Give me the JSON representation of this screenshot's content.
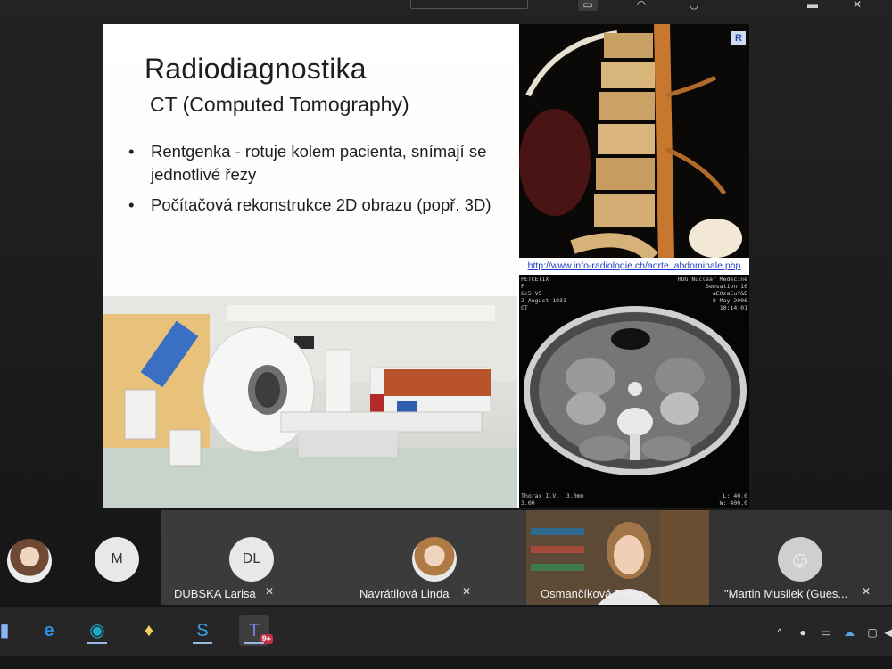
{
  "slide": {
    "title": "Radiodiagnostika",
    "subtitle": "CT (Computed Tomography)",
    "bullets": [
      "Rentgenka -  rotuje kolem pacienta, snímají se jednotlivé řezy",
      "Počítačová rekonstrukce 2D obrazu (popř. 3D)"
    ],
    "bullet_glyph": "•",
    "link": "http://www.info-radiologie.ch/aorte_abdominale.php",
    "spine_badge": "R",
    "scan_tl": "PETCETIX\nF\n6c5,VS\n2-August-1931\nCT",
    "scan_tr": "HUG Nuclear Medecine\nSensation 16\naE0zaEuf&E\n8-May-2006\n10:14:01",
    "scan_bl": "Thorax I.V.  3.0mm\n3.00",
    "scan_br": "L: 40.0\nW: 400.0"
  },
  "participants": [
    {
      "initials": "",
      "name": "",
      "kind": "photo"
    },
    {
      "initials": "M",
      "name": "",
      "kind": "initials"
    },
    {
      "initials": "DL",
      "name": "DUBSKA Larisa",
      "kind": "initials"
    },
    {
      "initials": "",
      "name": "Navrátilová Linda",
      "kind": "photo"
    },
    {
      "initials": "",
      "name": "Osmančíková Petra",
      "kind": "video"
    },
    {
      "initials": "",
      "name": "\"Martin Musilek (Gues...",
      "kind": "guest"
    }
  ],
  "mic_icon": "mic-off-icon",
  "taskbar": {
    "teams_badge": "9+"
  },
  "colors": {
    "taskbar": "#262626",
    "link": "#1f3cc6",
    "teams_badge": "#c4314b"
  }
}
